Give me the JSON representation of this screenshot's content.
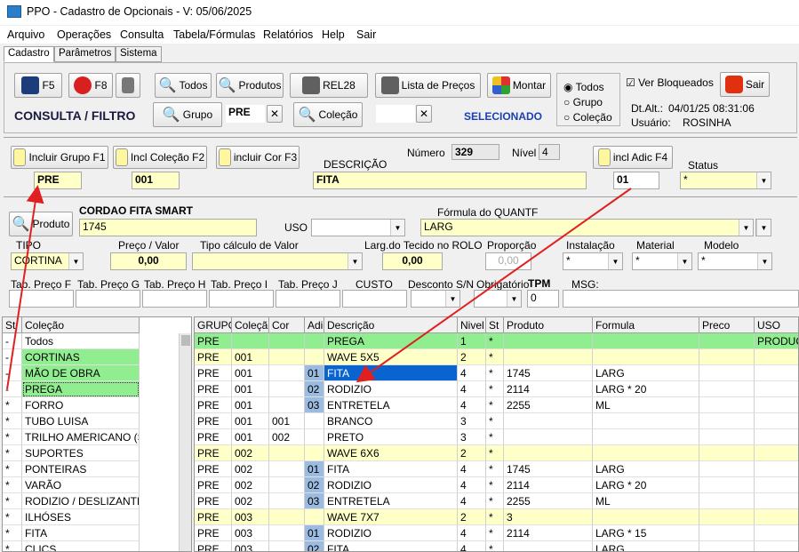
{
  "title": "PPO - Cadastro de Opcionais - V: 05/06/2025",
  "menu": [
    "Arquivo",
    "Operações",
    "Consulta",
    "Tabela/Fórmulas",
    "Relatórios",
    "Help",
    "Sair"
  ],
  "tabs": [
    "Cadastro",
    "Parâmetros",
    "Sistema"
  ],
  "toolbar": {
    "f5": "F5",
    "f8": "F8",
    "todos": "Todos",
    "produtos": "Produtos",
    "rel28": "REL28",
    "lista": "Lista de Preços",
    "montar": "Montar",
    "sair": "Sair",
    "grupo": "Grupo",
    "grupo_value": "PRE",
    "colecao": "Coleção",
    "colecao_value": "",
    "consulta_filtro": "CONSULTA / FILTRO",
    "selecionado": "SELECIONADO",
    "radio": [
      "Todos",
      "Grupo",
      "Coleção"
    ],
    "ver_bloqueados": "Ver Bloqueados",
    "dt_alt_label": "Dt.Alt.:",
    "dt_alt": "04/01/25  08:31:06",
    "usuario_label": "Usuário:",
    "usuario": "ROSINHA"
  },
  "header": {
    "incl_grupo": "Incluir Grupo F1",
    "incl_colecao": "Incl Coleção F2",
    "incl_cor": "incluir Cor F3",
    "incl_adic": "incl Adic F4",
    "numero_label": "Número",
    "numero": "329",
    "nivel_label": "Nível",
    "nivel": "4",
    "descricao_label": "DESCRIÇÃO",
    "grupo": "PRE",
    "colecao": "001",
    "descricao": "FITA",
    "adic": "01",
    "status_label": "Status",
    "status": "*"
  },
  "produto": {
    "btn": "Produto",
    "nome": "CORDAO FITA SMART",
    "codigo": "1745",
    "uso_label": "USO",
    "uso": "",
    "formula_label": "Fórmula do QUANTF",
    "formula": "LARG",
    "tipo_label": "TIPO",
    "tipo": "CORTINA",
    "preco_label": "Preço / Valor",
    "preco": "0,00",
    "tipo_calc_label": "Tipo cálculo de Valor",
    "tipo_calc": "",
    "larg_label": "Larg.do Tecido no ROLO",
    "larg": "0,00",
    "proporcao_label": "Proporção",
    "proporcao": "0,00",
    "instalacao_label": "Instalação",
    "instalacao": "*",
    "material_label": "Material",
    "material": "*",
    "modelo_label": "Modelo",
    "modelo": "*",
    "tab_f": "Tab. Preço F",
    "tab_g": "Tab. Preço G",
    "tab_h": "Tab. Preço H",
    "tab_i": "Tab. Preço I",
    "tab_j": "Tab. Preço J",
    "custo": "CUSTO",
    "desconto": "Desconto S/N",
    "obrigatorio": "Obrigatório",
    "tpm": "TPM",
    "tpm_value": "0",
    "msg": "MSG:"
  },
  "left_grid": {
    "headers": [
      "St",
      "Coleção"
    ],
    "rows": [
      [
        "-",
        "Todos"
      ],
      [
        "-",
        "CORTINAS"
      ],
      [
        "-",
        "MÃO DE OBRA"
      ],
      [
        "-",
        "PREGA"
      ],
      [
        "*",
        "FORRO"
      ],
      [
        "*",
        "TUBO LUISA"
      ],
      [
        "*",
        "TRILHO AMERICANO (SIDN"
      ],
      [
        "*",
        "SUPORTES"
      ],
      [
        "*",
        "PONTEIRAS"
      ],
      [
        "*",
        "VARÃO"
      ],
      [
        "*",
        "RODIZIO / DESLIZANTE"
      ],
      [
        "*",
        "ILHÓSES"
      ],
      [
        "*",
        "FITA"
      ],
      [
        "*",
        "CLICS"
      ]
    ]
  },
  "right_grid": {
    "headers": [
      "GRUPO",
      "Coleção",
      "Cor",
      "Adic",
      "Descrição",
      "Nivel",
      "St",
      "Produto",
      "Formula",
      "Preco",
      "USO"
    ],
    "rows": [
      [
        "PRE",
        "",
        "",
        "",
        "PREGA",
        "1",
        "*",
        "",
        "",
        "",
        "PRODUCAO"
      ],
      [
        "PRE",
        "001",
        "",
        "",
        "WAVE 5X5",
        "2",
        "*",
        "",
        "",
        "",
        ""
      ],
      [
        "PRE",
        "001",
        "",
        "01",
        "FITA",
        "4",
        "*",
        "1745",
        "LARG",
        "",
        ""
      ],
      [
        "PRE",
        "001",
        "",
        "02",
        "RODIZIO",
        "4",
        "*",
        "2114",
        "LARG * 20",
        "",
        ""
      ],
      [
        "PRE",
        "001",
        "",
        "03",
        "ENTRETELA",
        "4",
        "*",
        "2255",
        "ML",
        "",
        ""
      ],
      [
        "PRE",
        "001",
        "001",
        "",
        "BRANCO",
        "3",
        "*",
        "",
        "",
        "",
        ""
      ],
      [
        "PRE",
        "001",
        "002",
        "",
        "PRETO",
        "3",
        "*",
        "",
        "",
        "",
        ""
      ],
      [
        "PRE",
        "002",
        "",
        "",
        "WAVE 6X6",
        "2",
        "*",
        "",
        "",
        "",
        ""
      ],
      [
        "PRE",
        "002",
        "",
        "01",
        "FITA",
        "4",
        "*",
        "1745",
        "LARG",
        "",
        ""
      ],
      [
        "PRE",
        "002",
        "",
        "02",
        "RODIZIO",
        "4",
        "*",
        "2114",
        "LARG * 20",
        "",
        ""
      ],
      [
        "PRE",
        "002",
        "",
        "03",
        "ENTRETELA",
        "4",
        "*",
        "2255",
        "ML",
        "",
        ""
      ],
      [
        "PRE",
        "003",
        "",
        "",
        "WAVE 7X7",
        "2",
        "*",
        "3",
        "",
        "",
        ""
      ],
      [
        "PRE",
        "003",
        "",
        "01",
        "RODIZIO",
        "4",
        "*",
        "2114",
        "LARG * 15",
        "",
        ""
      ],
      [
        "PRE",
        "003",
        "",
        "02",
        "FITA",
        "4",
        "*",
        "",
        "LARG",
        "",
        ""
      ]
    ]
  },
  "colors": {
    "green": "#90ee90",
    "yellow": "#ffffc8",
    "select": "#0a64d0",
    "adic": "#9bbbe0",
    "arrow": "#e02020"
  }
}
